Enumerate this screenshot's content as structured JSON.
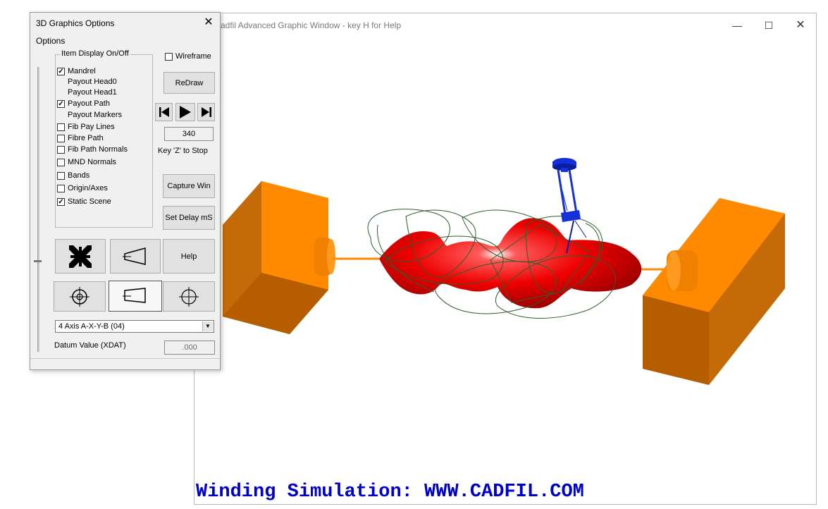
{
  "main_window": {
    "title": "adfil Advanced Graphic Window - key H for Help",
    "minimize_glyph": "—",
    "maximize_glyph": "☐",
    "close_glyph": "✕",
    "caption": "Winding Simulation: WWW.CADFIL.COM"
  },
  "dialog": {
    "title": "3D Graphics Options",
    "close_glyph": "✕",
    "menu": "Options",
    "group_label": "Item Display On/Off",
    "items": [
      {
        "label": "Mandrel",
        "checked": true,
        "box": true
      },
      {
        "label": "Payout Head0",
        "checked": false,
        "box": false
      },
      {
        "label": "Payout Head1",
        "checked": false,
        "box": false
      },
      {
        "label": "Payout Path",
        "checked": true,
        "box": true
      },
      {
        "label": "Payout Markers",
        "checked": false,
        "box": false
      },
      {
        "label": "Fib Pay Lines",
        "checked": false,
        "box": true
      },
      {
        "label": "Fibre Path",
        "checked": false,
        "box": true
      },
      {
        "label": "Fib Path Normals",
        "checked": false,
        "box": true
      },
      {
        "label": "MND Normals",
        "checked": false,
        "box": true
      },
      {
        "label": "Bands",
        "checked": false,
        "box": true
      },
      {
        "label": "Origin/Axes",
        "checked": false,
        "box": true
      },
      {
        "label": "Static Scene",
        "checked": true,
        "box": true
      }
    ],
    "wireframe_label": "Wireframe",
    "wireframe_checked": false,
    "redraw_label": "ReDraw",
    "counter_value": "340",
    "key_z_label": "Key 'Z' to Stop",
    "capture_label": "Capture Win",
    "set_delay_label": "Set Delay mS",
    "help_label": "Help",
    "axis_select_value": "4 Axis A-X-Y-B (04)",
    "datum_label": "Datum Value (XDAT)",
    "datum_value": ".000",
    "check_glyph": "✓"
  },
  "colors": {
    "chuck_orange": "#ff8a00",
    "chuck_dark": "#b05a00",
    "mandrel_red": "#ee0000",
    "payout_path_green": "#2e5e2e",
    "payout_head_blue": "#1530d8",
    "caption_blue": "#0000cc"
  }
}
